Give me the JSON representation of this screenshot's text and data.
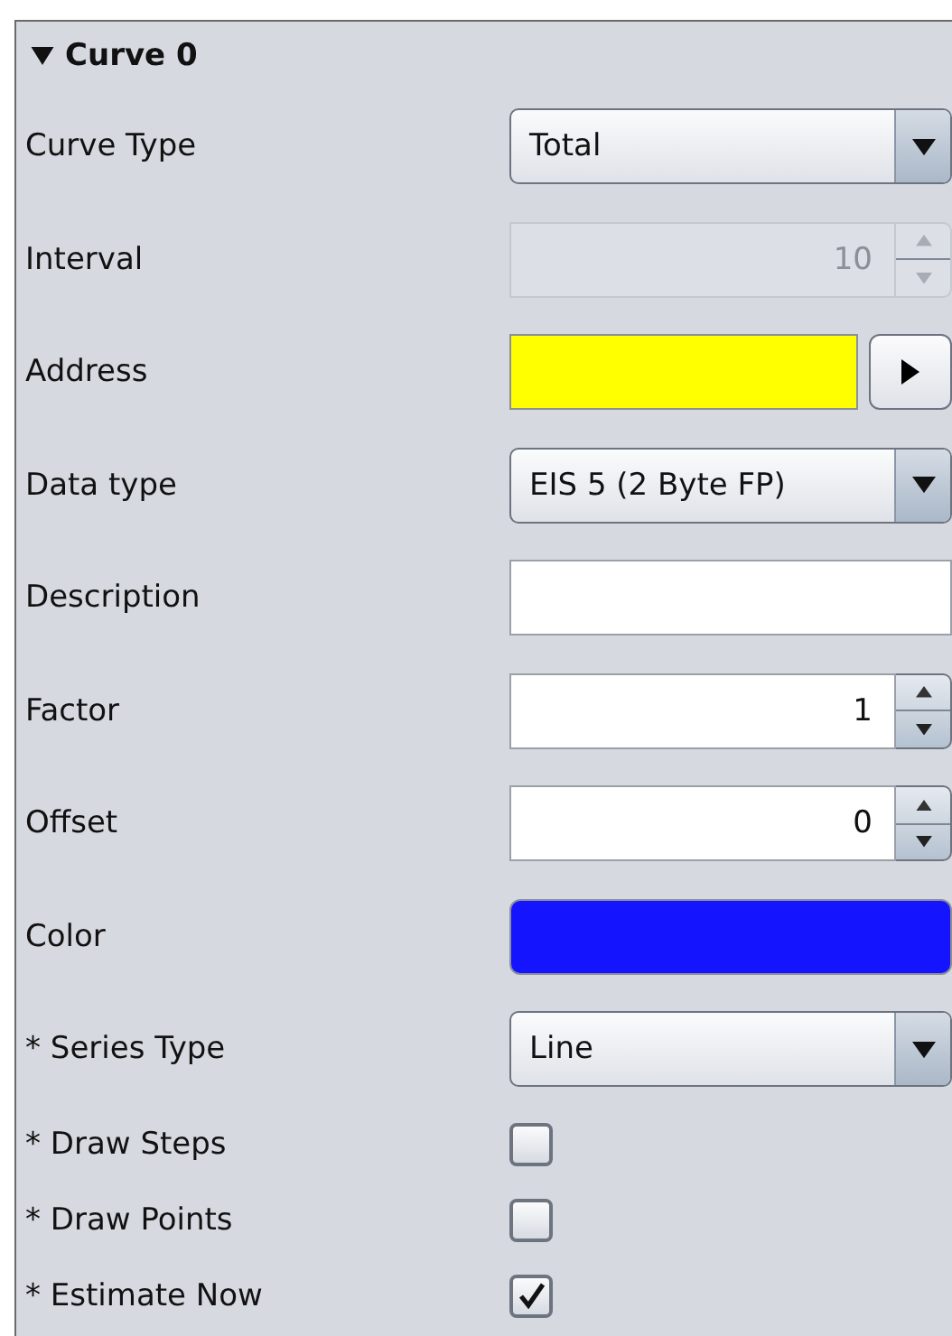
{
  "section": {
    "title": "Curve 0",
    "expanded": true
  },
  "rows": [
    {
      "kind": "select",
      "label": "Curve Type",
      "value": "Total"
    },
    {
      "kind": "spinner",
      "label": "Interval",
      "value": "10",
      "disabled": true
    },
    {
      "kind": "address",
      "label": "Address",
      "color": "#ffff00"
    },
    {
      "kind": "select",
      "label": "Data type",
      "value": "EIS 5 (2 Byte FP)"
    },
    {
      "kind": "text",
      "label": "Description"
    },
    {
      "kind": "spinner",
      "label": "Factor",
      "value": "1",
      "disabled": false
    },
    {
      "kind": "spinner",
      "label": "Offset",
      "value": "0",
      "disabled": false
    },
    {
      "kind": "color",
      "label": "Color",
      "color": "#1414ff"
    },
    {
      "kind": "select",
      "label": "* Series Type",
      "value": "Line"
    },
    {
      "kind": "checkbox",
      "label": "* Draw Steps",
      "checked": false
    },
    {
      "kind": "checkbox",
      "label": "* Draw Points",
      "checked": false
    },
    {
      "kind": "checkbox",
      "label": "* Estimate Now",
      "checked": true
    }
  ]
}
